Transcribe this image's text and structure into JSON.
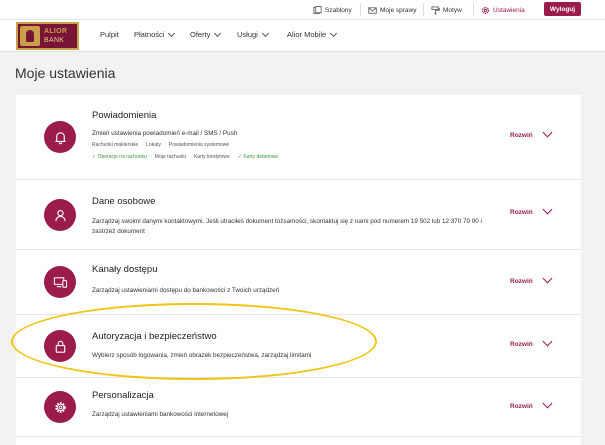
{
  "topbar": {
    "items": [
      {
        "label": "Szablony",
        "icon": "templates-icon"
      },
      {
        "label": "Moje sprawy",
        "icon": "mail-icon"
      },
      {
        "label": "Motyw",
        "icon": "paint-roller-icon"
      },
      {
        "label": "Ustawienia",
        "icon": "gear-icon",
        "active": true
      }
    ],
    "logout": "Wyloguj"
  },
  "brand": {
    "line1": "ALIOR",
    "line2": "BANK"
  },
  "nav": {
    "items": [
      {
        "label": "Pulpit",
        "dropdown": false
      },
      {
        "label": "Płatności",
        "dropdown": true
      },
      {
        "label": "Oferty",
        "dropdown": true
      },
      {
        "label": "Usługi",
        "dropdown": true
      },
      {
        "label": "Alior Mobile",
        "dropdown": true
      }
    ]
  },
  "page": {
    "title": "Moje ustawienia"
  },
  "sections": {
    "notifications": {
      "title": "Powiadomienia",
      "desc": "Zmień ustawienia powiadomień e-mail / SMS / Push",
      "tags1": [
        "Rachunki maklerskie",
        "Lokaty",
        "Powiadomienia systemowe"
      ],
      "tags2": [
        {
          "label": "Operacje na rachunku",
          "checked": true
        },
        {
          "label": "Moje rachunki",
          "checked": false
        },
        {
          "label": "Karty kredytowe",
          "checked": false
        },
        {
          "label": "Karty debetowe",
          "checked": true
        }
      ],
      "expand": "Rozwiń",
      "icon": "bell-icon"
    },
    "personal": {
      "title": "Dane osobowe",
      "desc": "Zarządzaj swoimi danymi kontaktowymi. Jeśli utraciłeś dokument tożsamości, skontaktuj się z nami pod numerem 19 502 lub 12 370 70 00 i zastrzeż dokument",
      "expand": "Rozwiń",
      "icon": "user-icon"
    },
    "access": {
      "title": "Kanały dostępu",
      "desc": "Zarządzaj ustawieniami dostępu do bankowości z Twoich urządzeń",
      "expand": "Rozwiń",
      "icon": "devices-icon"
    },
    "security": {
      "title": "Autoryzacja i bezpieczeństwo",
      "desc": "Wybierz sposób logowania, zmień obrazek bezpieczeństwa, zarządzaj limitami",
      "expand": "Rozwiń",
      "icon": "lock-icon"
    },
    "personalization": {
      "title": "Personalizacja",
      "desc": "Zarządzaj ustawieniami bankowości internetowej",
      "expand": "Rozwiń",
      "icon": "gear-icon"
    }
  },
  "colors": {
    "accent": "#9b1b4b",
    "highlight": "#f0c419",
    "check": "#3a9a3a"
  }
}
